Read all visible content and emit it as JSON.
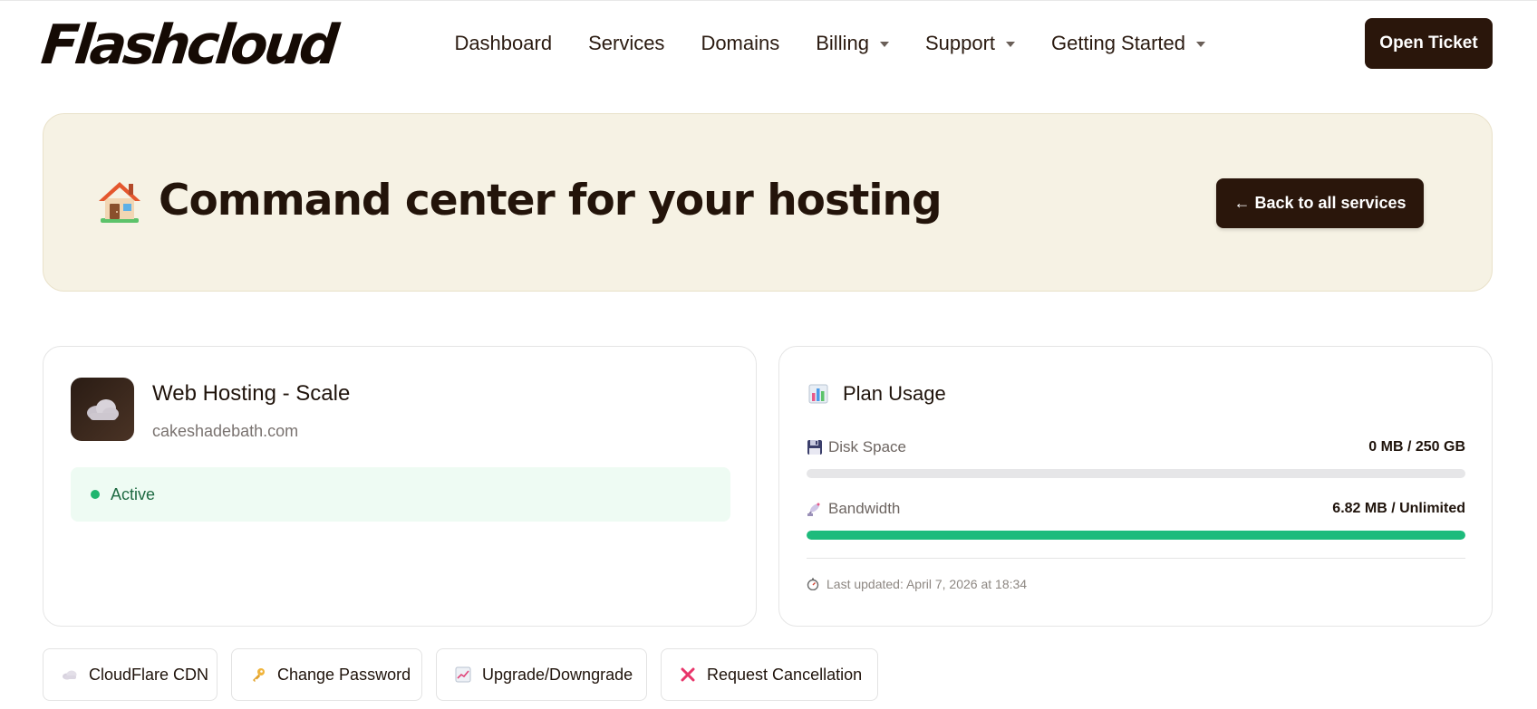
{
  "brand": {
    "logo_text": "Flashcloud"
  },
  "nav": {
    "items": [
      {
        "label": "Dashboard",
        "has_dropdown": false
      },
      {
        "label": "Services",
        "has_dropdown": false
      },
      {
        "label": "Domains",
        "has_dropdown": false
      },
      {
        "label": "Billing",
        "has_dropdown": true
      },
      {
        "label": "Support",
        "has_dropdown": true
      },
      {
        "label": "Getting Started",
        "has_dropdown": true
      }
    ],
    "open_ticket_label": "Open Ticket"
  },
  "hero": {
    "icon": "house-icon",
    "title": "Command center for your hosting",
    "back_button_label": "← Back to all services"
  },
  "service": {
    "icon": "cloud-icon",
    "name": "Web Hosting - Scale",
    "domain": "cakeshadebath.com",
    "status": "Active",
    "status_color": "#1fb56e"
  },
  "usage": {
    "title": "Plan Usage",
    "icon": "bar-chart-icon",
    "disk": {
      "label": "Disk Space",
      "icon": "floppy-disk-icon",
      "value": "0 MB / 250 GB",
      "fill_fraction": 0
    },
    "bandwidth": {
      "label": "Bandwidth",
      "icon": "satellite-icon",
      "value": "6.82 MB / Unlimited",
      "fill_fraction": 1.0
    },
    "last_updated": "Last updated: April 7, 2026 at 18:34",
    "accent_color": "#1dbb7c"
  },
  "actions": [
    {
      "label": "CloudFlare CDN",
      "icon": "cloud-icon"
    },
    {
      "label": "Change Password",
      "icon": "key-icon"
    },
    {
      "label": "Upgrade/Downgrade",
      "icon": "chart-increasing-icon"
    },
    {
      "label": "Request Cancellation",
      "icon": "cross-mark-icon"
    }
  ],
  "colors": {
    "primary_dark": "#2a160b",
    "hero_bg": "#f6f2e4",
    "status_bg": "#eefbf3"
  }
}
